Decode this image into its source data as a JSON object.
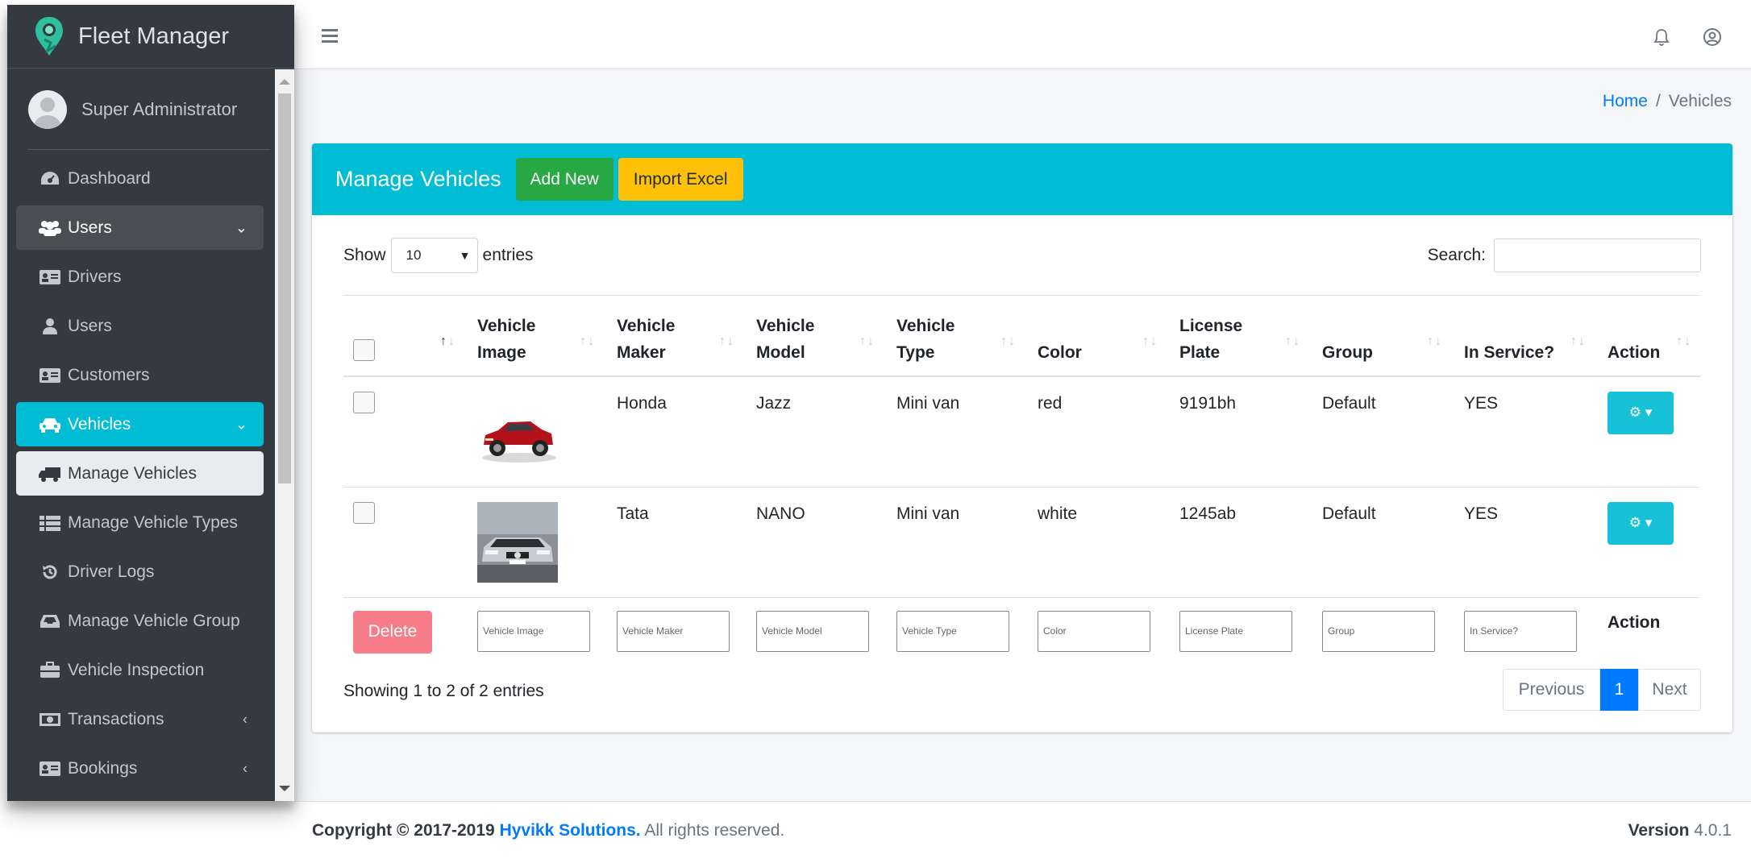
{
  "brand": {
    "name": "Fleet Manager"
  },
  "user": {
    "name": "Super Administrator"
  },
  "sidebar": {
    "items": [
      {
        "label": "Dashboard",
        "icon": "dashboard-icon"
      },
      {
        "label": "Users",
        "icon": "users-icon",
        "state": "open"
      },
      {
        "label": "Drivers",
        "icon": "id-card-icon"
      },
      {
        "label": "Users",
        "icon": "user-icon"
      },
      {
        "label": "Customers",
        "icon": "address-card-icon"
      },
      {
        "label": "Vehicles",
        "icon": "taxi-icon",
        "state": "active"
      },
      {
        "label": "Manage Vehicles",
        "icon": "truck-icon",
        "state": "sub-active"
      },
      {
        "label": "Manage Vehicle Types",
        "icon": "list-icon"
      },
      {
        "label": "Driver Logs",
        "icon": "history-icon"
      },
      {
        "label": "Manage Vehicle Group",
        "icon": "inbox-icon"
      },
      {
        "label": "Vehicle Inspection",
        "icon": "briefcase-icon"
      },
      {
        "label": "Transactions",
        "icon": "money-icon"
      },
      {
        "label": "Bookings",
        "icon": "address-card-icon"
      }
    ]
  },
  "breadcrumb": {
    "home": "Home",
    "separator": "/",
    "current": "Vehicles"
  },
  "card": {
    "title": "Manage Vehicles",
    "add_new": "Add New",
    "import_excel": "Import Excel"
  },
  "table_controls": {
    "show": "Show",
    "entries_value": "10",
    "entries": "entries",
    "search_label": "Search:"
  },
  "table": {
    "headers": [
      {
        "line1": "Vehicle",
        "line2": "Image"
      },
      {
        "line1": "Vehicle",
        "line2": "Maker"
      },
      {
        "line1": "Vehicle",
        "line2": "Model"
      },
      {
        "line1": "Vehicle",
        "line2": "Type"
      },
      {
        "line1": "",
        "line2": "Color"
      },
      {
        "line1": "License",
        "line2": "Plate"
      },
      {
        "line1": "",
        "line2": "Group"
      },
      {
        "line1": "",
        "line2": "In Service?"
      },
      {
        "line1": "",
        "line2": "Action"
      }
    ],
    "rows": [
      {
        "maker": "Honda",
        "model": "Jazz",
        "type": "Mini van",
        "color": "red",
        "plate": "9191bh",
        "group": "Default",
        "in_service": "YES"
      },
      {
        "maker": "Tata",
        "model": "NANO",
        "type": "Mini van",
        "color": "white",
        "plate": "1245ab",
        "group": "Default",
        "in_service": "YES"
      }
    ],
    "filters": {
      "delete": "Delete",
      "placeholders": [
        "Vehicle Image",
        "Vehicle Maker",
        "Vehicle Model",
        "Vehicle Type",
        "Color",
        "License Plate",
        "Group",
        "In Service?"
      ],
      "action": "Action"
    }
  },
  "info": "Showing 1 to 2 of 2 entries",
  "pagination": {
    "previous": "Previous",
    "current": "1",
    "next": "Next"
  },
  "footer": {
    "copyright": "Copyright © 2017-2019",
    "company": "Hyvikk Solutions.",
    "rights": "All rights reserved.",
    "version_label": "Version",
    "version": "4.0.1"
  },
  "colors": {
    "sidebar": "#343a40",
    "accent": "#00bcd4",
    "success": "#28a745",
    "warning": "#ffc107",
    "danger_light": "#f57c88",
    "link": "#007bff"
  }
}
